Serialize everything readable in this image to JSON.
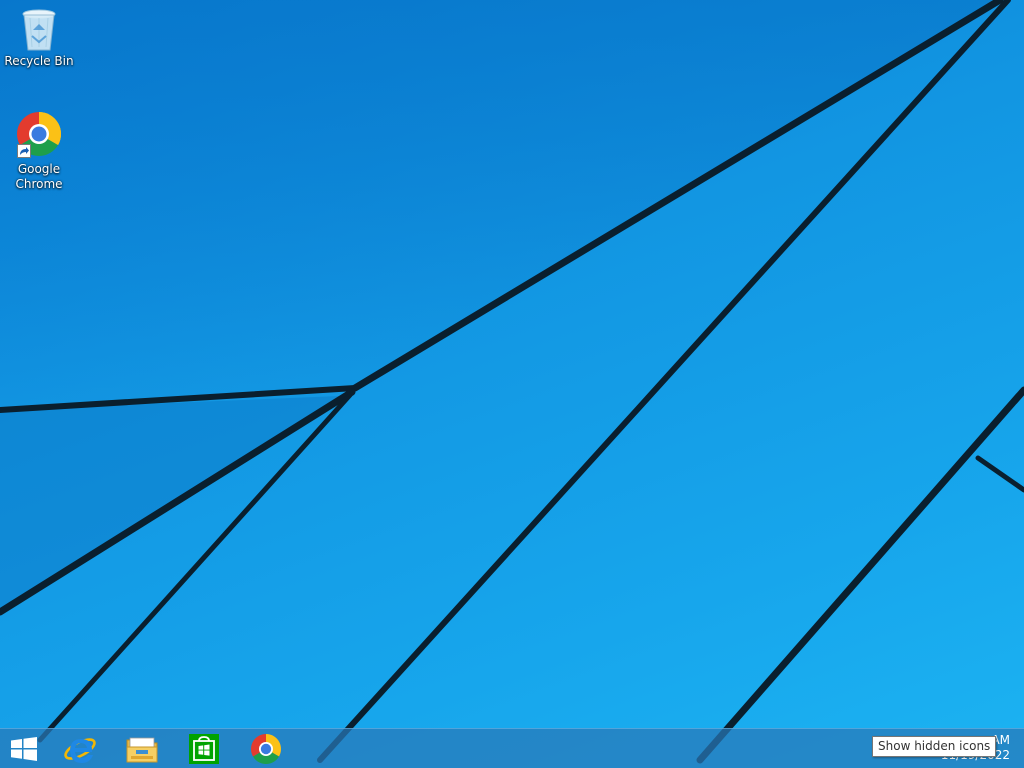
{
  "desktop": {
    "icons": [
      {
        "label": "Recycle Bin",
        "icon": "recycle-bin-icon"
      },
      {
        "label": "Google\nChrome",
        "icon": "chrome-icon",
        "shortcut": true
      }
    ]
  },
  "taskbar": {
    "start": {
      "icon": "windows-logo-icon"
    },
    "pinned": [
      {
        "name": "internet-explorer",
        "icon": "internet-explorer-icon"
      },
      {
        "name": "file-explorer",
        "icon": "folder-icon"
      },
      {
        "name": "store",
        "icon": "store-icon"
      },
      {
        "name": "google-chrome",
        "icon": "chrome-icon"
      }
    ],
    "tray": {
      "time": "AM",
      "date": "11/19/2022"
    }
  },
  "tooltip": {
    "text": "Show hidden icons"
  },
  "colors": {
    "wallpaper": "#1296e2",
    "taskbar": "#2878b9",
    "store_green": "#00a300",
    "ie_blue": "#1e88e5"
  }
}
